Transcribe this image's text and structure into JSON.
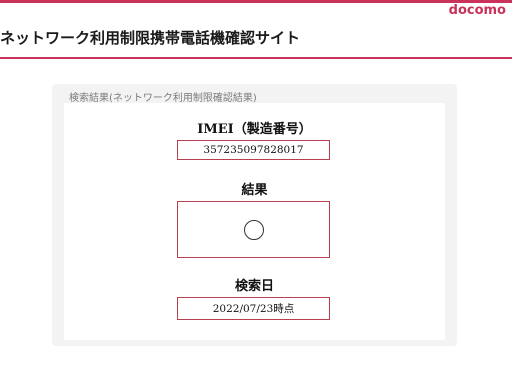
{
  "header": {
    "brand": "docomo",
    "title": "ネットワーク利用制限携帯電話機確認サイト"
  },
  "result_panel": {
    "caption": "検索結果(ネットワーク利用制限確認結果)",
    "imei_label": "IMEI（製造番号）",
    "imei_value": "357235097828017",
    "result_label": "結果",
    "result_symbol": "circle-symbol",
    "search_date_label": "検索日",
    "search_date_value": "2022/07/23時点"
  },
  "colors": {
    "accent": "#c9335b",
    "box_border": "#b6404f",
    "panel_bg": "#f3f3f3"
  }
}
